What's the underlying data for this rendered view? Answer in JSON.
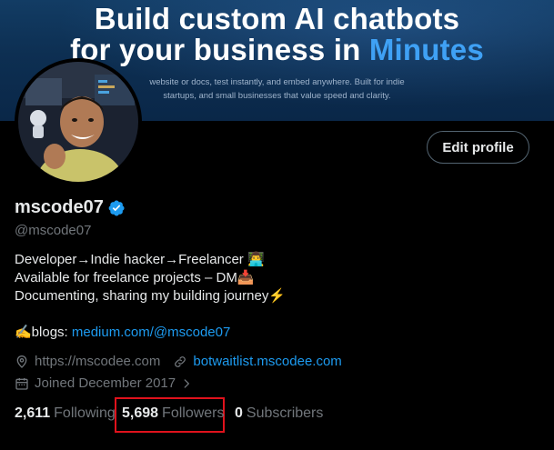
{
  "banner": {
    "line1": "Build custom AI chatbots",
    "line2_prefix": "for your business in ",
    "line2_accent": "Minutes",
    "sub1": "website or docs, test instantly, and embed anywhere. Built for indie",
    "sub2": "startups, and small businesses that value speed and clarity."
  },
  "profile": {
    "display_name": "mscode07",
    "handle": "@mscode07",
    "edit_button": "Edit profile",
    "bio": [
      "Developer→Indie hacker→Freelancer 👨‍💻",
      "Available for freelance projects – DM📥",
      "Documenting, sharing my building journey⚡"
    ],
    "blogs_prefix": "✍blogs: ",
    "blogs_link": "medium.com/@mscode07",
    "location": "https://mscodee.com",
    "website": "botwaitlist.mscodee.com",
    "joined": "Joined December 2017",
    "icons": [
      "location-icon",
      "link-icon",
      "calendar-icon",
      "chevron-right-icon",
      "verified-badge-icon"
    ]
  },
  "stats": {
    "following_count": "2,611",
    "following_label": "Following",
    "followers_count": "5,698",
    "followers_label": "Followers",
    "subscribers_count": "0",
    "subscribers_label": "Subscribers"
  },
  "colors": {
    "accent": "#1d9bf0",
    "highlight_box": "#e0121c",
    "verified": "#1d9bf0"
  }
}
